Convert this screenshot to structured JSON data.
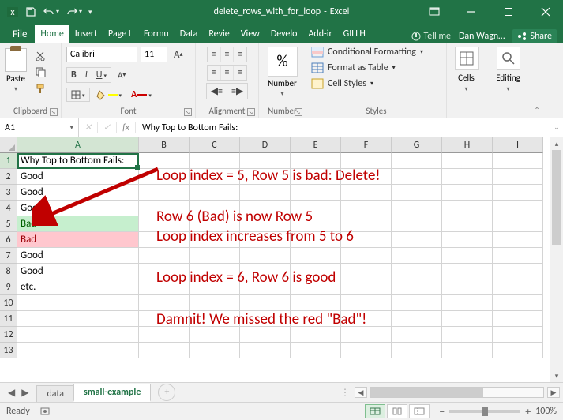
{
  "title": {
    "doc": "delete_rows_with_for_loop",
    "app": "Excel"
  },
  "qat": {
    "save": "save-icon",
    "undo": "undo-icon",
    "redo": "redo-icon"
  },
  "tabs": {
    "file": "File",
    "list": [
      "Home",
      "Insert",
      "Page L",
      "Formu",
      "Data",
      "Revie",
      "View",
      "Develo",
      "Add-ir",
      "GILLH"
    ],
    "active": "Home",
    "tellme": "Tell me",
    "user": "Dan Wagn…",
    "share": "Share"
  },
  "ribbon": {
    "clipboard": {
      "paste": "Paste",
      "label": "Clipboard"
    },
    "font": {
      "name": "Calibri",
      "size": "11",
      "label": "Font"
    },
    "alignment": {
      "label": "Alignment"
    },
    "number": {
      "percent": "%",
      "label": "Number",
      "btn": "Number"
    },
    "styles": {
      "cond": "Conditional Formatting",
      "table": "Format as Table",
      "cell": "Cell Styles",
      "label": "Styles"
    },
    "cells": {
      "btn": "Cells"
    },
    "editing": {
      "btn": "Editing",
      "label": ""
    }
  },
  "namebox": "A1",
  "formula": "Why Top to Bottom Fails:",
  "columns": [
    "A",
    "B",
    "C",
    "D",
    "E",
    "F",
    "G",
    "H",
    "I"
  ],
  "rows": [
    {
      "n": 1,
      "a": "Why Top to Bottom Fails:"
    },
    {
      "n": 2,
      "a": "Good"
    },
    {
      "n": 3,
      "a": "Good"
    },
    {
      "n": 4,
      "a": "Good"
    },
    {
      "n": 5,
      "a": "Bad",
      "fill": "#C6EFCE",
      "color": "#006100"
    },
    {
      "n": 6,
      "a": "Bad",
      "fill": "#FFC7CE",
      "color": "#9C0006"
    },
    {
      "n": 7,
      "a": "Good"
    },
    {
      "n": 8,
      "a": "Good"
    },
    {
      "n": 9,
      "a": "etc."
    },
    {
      "n": 10,
      "a": ""
    },
    {
      "n": 11,
      "a": ""
    },
    {
      "n": 12,
      "a": ""
    },
    {
      "n": 13,
      "a": ""
    }
  ],
  "annotations": {
    "l1": "Loop index = 5, Row 5 is bad: Delete!",
    "l2": "Row 6 (Bad) is now Row 5",
    "l3": "Loop index increases from 5 to 6",
    "l4": "Loop index = 6, Row 6 is good",
    "l5": "Damnit! We missed the red \"Bad\"!"
  },
  "sheets": {
    "list": [
      "data",
      "small-example"
    ],
    "active": "small-example"
  },
  "status": {
    "ready": "Ready",
    "zoom": "100%"
  }
}
